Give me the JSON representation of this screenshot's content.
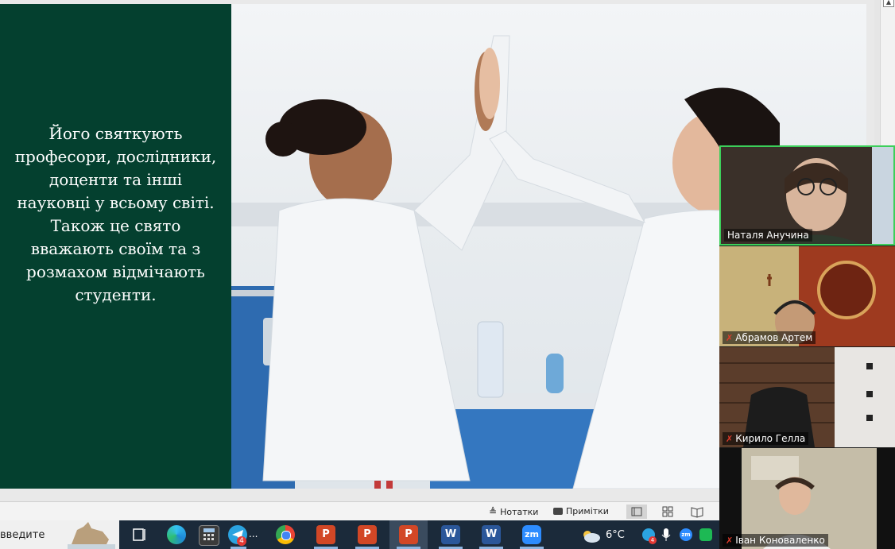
{
  "slide": {
    "text": "Його святкують професори, дослідники, доценти та інші науковці у всьому світі. Також це свято вважають своїм та з розмахом відмічають студенти.",
    "panel_color": "#04402f"
  },
  "statusbar": {
    "notes_label": "Нотатки",
    "comments_label": "Примітки"
  },
  "taskbar": {
    "search_text": "введите",
    "telegram_badge": "4",
    "telegram_more": "...",
    "temperature": "6°C",
    "tray_badge": "4",
    "apps": [
      "task-view",
      "edge",
      "calculator",
      "telegram",
      "chrome",
      "powerpoint",
      "powerpoint",
      "powerpoint",
      "word",
      "word",
      "zoom"
    ]
  },
  "participants": [
    {
      "name": "Наталя Анучина",
      "muted": false,
      "active": true
    },
    {
      "name": "Абрамов Артем",
      "muted": true,
      "active": false
    },
    {
      "name": "Кирило Гелла",
      "muted": true,
      "active": false
    },
    {
      "name": "Іван Коноваленко",
      "muted": true,
      "active": false
    }
  ]
}
